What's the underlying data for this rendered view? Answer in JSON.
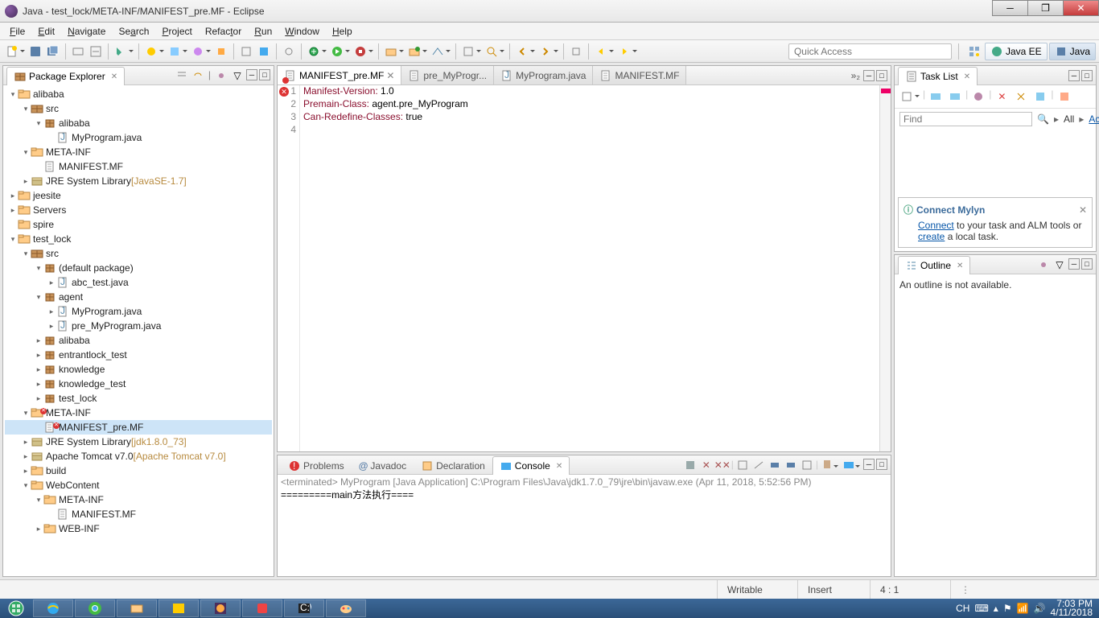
{
  "window": {
    "title": "Java - test_lock/META-INF/MANIFEST_pre.MF - Eclipse"
  },
  "menu": [
    "File",
    "Edit",
    "Navigate",
    "Search",
    "Project",
    "Refactor",
    "Run",
    "Window",
    "Help"
  ],
  "quickAccess": "Quick Access",
  "perspectives": {
    "javaee": "Java EE",
    "java": "Java"
  },
  "packageExplorer": {
    "title": "Package Explorer",
    "tree": [
      {
        "d": 0,
        "e": "▾",
        "i": "proj",
        "t": "alibaba"
      },
      {
        "d": 1,
        "e": "▾",
        "i": "srcf",
        "t": "src"
      },
      {
        "d": 2,
        "e": "▾",
        "i": "pkg",
        "t": "alibaba"
      },
      {
        "d": 3,
        "e": "",
        "i": "java",
        "t": "MyProgram.java"
      },
      {
        "d": 1,
        "e": "▾",
        "i": "fold",
        "t": "META-INF"
      },
      {
        "d": 2,
        "e": "",
        "i": "file",
        "t": "MANIFEST.MF"
      },
      {
        "d": 1,
        "e": "▸",
        "i": "jar",
        "t": "JRE System Library",
        "suf": "[JavaSE-1.7]"
      },
      {
        "d": 0,
        "e": "▸",
        "i": "proj",
        "t": "jeesite"
      },
      {
        "d": 0,
        "e": "▸",
        "i": "fold",
        "t": "Servers"
      },
      {
        "d": 0,
        "e": "",
        "i": "fold",
        "t": "spire"
      },
      {
        "d": 0,
        "e": "▾",
        "i": "proj",
        "t": "test_lock"
      },
      {
        "d": 1,
        "e": "▾",
        "i": "srcf",
        "t": "src"
      },
      {
        "d": 2,
        "e": "▾",
        "i": "pkg",
        "t": "(default package)"
      },
      {
        "d": 3,
        "e": "▸",
        "i": "java",
        "t": "abc_test.java"
      },
      {
        "d": 2,
        "e": "▾",
        "i": "pkg",
        "t": "agent"
      },
      {
        "d": 3,
        "e": "▸",
        "i": "java",
        "t": "MyProgram.java"
      },
      {
        "d": 3,
        "e": "▸",
        "i": "java",
        "t": "pre_MyProgram.java"
      },
      {
        "d": 2,
        "e": "▸",
        "i": "pkg",
        "t": "alibaba"
      },
      {
        "d": 2,
        "e": "▸",
        "i": "pkg",
        "t": "entrantlock_test"
      },
      {
        "d": 2,
        "e": "▸",
        "i": "pkg",
        "t": "knowledge"
      },
      {
        "d": 2,
        "e": "▸",
        "i": "pkg",
        "t": "knowledge_test"
      },
      {
        "d": 2,
        "e": "▸",
        "i": "pkg",
        "t": "test_lock"
      },
      {
        "d": 1,
        "e": "▾",
        "i": "fold",
        "t": "META-INF",
        "err": true
      },
      {
        "d": 2,
        "e": "",
        "i": "file",
        "t": "MANIFEST_pre.MF",
        "sel": true,
        "err": true
      },
      {
        "d": 1,
        "e": "▸",
        "i": "jar",
        "t": "JRE System Library",
        "suf": "[jdk1.8.0_73]"
      },
      {
        "d": 1,
        "e": "▸",
        "i": "jar",
        "t": "Apache Tomcat v7.0",
        "suf": "[Apache Tomcat v7.0]"
      },
      {
        "d": 1,
        "e": "▸",
        "i": "fold",
        "t": "build"
      },
      {
        "d": 1,
        "e": "▾",
        "i": "fold",
        "t": "WebContent"
      },
      {
        "d": 2,
        "e": "▾",
        "i": "fold",
        "t": "META-INF"
      },
      {
        "d": 3,
        "e": "",
        "i": "file",
        "t": "MANIFEST.MF"
      },
      {
        "d": 2,
        "e": "▸",
        "i": "fold",
        "t": "WEB-INF"
      }
    ]
  },
  "editor": {
    "tabs": [
      {
        "label": "MANIFEST_pre.MF",
        "active": true,
        "closable": true,
        "err": true
      },
      {
        "label": "pre_MyProgr...",
        "active": false
      },
      {
        "label": "MyProgram.java",
        "active": false
      },
      {
        "label": "MANIFEST.MF",
        "active": false
      }
    ],
    "overflow": "»₂",
    "lines": [
      "Manifest-Version: 1.0",
      "Premain-Class: agent.pre_MyProgram",
      "Can-Redefine-Classes: true",
      ""
    ]
  },
  "bottomViews": {
    "tabs": [
      "Problems",
      "Javadoc",
      "Declaration",
      "Console"
    ],
    "activeTab": "Console",
    "termLine": "<terminated> MyProgram [Java Application] C:\\Program Files\\Java\\jdk1.7.0_79\\jre\\bin\\javaw.exe (Apr 11, 2018, 5:52:56 PM)",
    "output": "=========main方法执行===="
  },
  "taskList": {
    "title": "Task List",
    "find": "Find",
    "all": "All",
    "activate": "Activate...",
    "mylynTitle": "Connect Mylyn",
    "mylynText1": "Connect",
    "mylynText2": " to your task and ALM tools or ",
    "mylynText3": "create",
    "mylynText4": " a local task."
  },
  "outline": {
    "title": "Outline",
    "msg": "An outline is not available."
  },
  "status": {
    "writable": "Writable",
    "insert": "Insert",
    "pos": "4 : 1"
  },
  "taskbar": {
    "lang": "CH",
    "time": "7:03 PM",
    "date": "4/11/2018"
  }
}
